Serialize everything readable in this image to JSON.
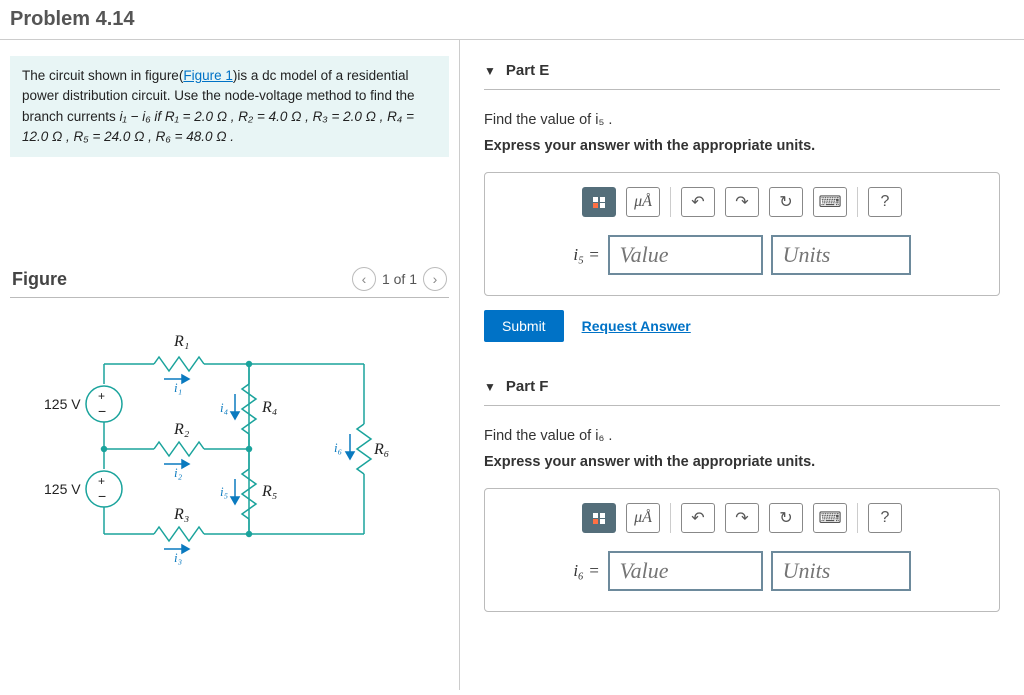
{
  "title": "Problem 4.14",
  "problem": {
    "pretext": "The circuit shown in figure(",
    "link": "Figure 1",
    "posttext": ")is a dc model of a residential power distribution circuit. Use the node-voltage method to find the branch currents ",
    "range": "i₁  −  i₆",
    "cond": " if R₁ = 2.0 Ω , R₂ = 4.0 Ω , R₃ = 2.0 Ω , R₄ = 12.0 Ω , R₅ = 24.0 Ω , R₆ = 48.0 Ω ."
  },
  "figure": {
    "heading": "Figure",
    "counter": "1 of 1",
    "v_label": "125 V",
    "r": {
      "r1": "R₁",
      "r2": "R₂",
      "r3": "R₃",
      "r4": "R₄",
      "r5": "R₅",
      "r6": "R₆"
    },
    "i": {
      "i1": "i₁",
      "i2": "i₂",
      "i3": "i₃",
      "i4": "i₄",
      "i5": "i₅",
      "i6": "i₆"
    }
  },
  "partE": {
    "title": "Part E",
    "prompt": "Find the value of i₅ .",
    "instr": "Express your answer with the appropriate units.",
    "eq": "i₅ =",
    "value_ph": "Value",
    "units_ph": "Units",
    "submit": "Submit",
    "request": "Request Answer",
    "ua": "μÅ"
  },
  "partF": {
    "title": "Part F",
    "prompt": "Find the value of i₆ .",
    "instr": "Express your answer with the appropriate units.",
    "eq": "i₆ =",
    "value_ph": "Value",
    "units_ph": "Units",
    "ua": "μÅ"
  }
}
